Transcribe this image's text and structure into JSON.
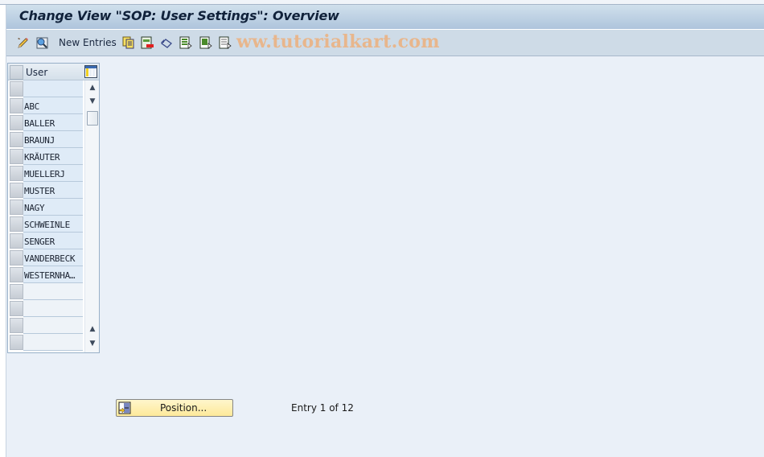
{
  "window": {
    "title": "Change View \"SOP: User Settings\": Overview"
  },
  "toolbar": {
    "items": [
      {
        "icon": "display-change-icon",
        "label": ""
      },
      {
        "icon": "details-icon",
        "label": ""
      },
      {
        "icon": "",
        "label": "New Entries"
      },
      {
        "icon": "copy-as-icon",
        "label": ""
      },
      {
        "icon": "delete-icon",
        "label": ""
      },
      {
        "icon": "undo-change-icon",
        "label": ""
      },
      {
        "icon": "select-all-icon",
        "label": ""
      },
      {
        "icon": "select-block-icon",
        "label": ""
      },
      {
        "icon": "deselect-all-icon",
        "label": ""
      }
    ],
    "new_entries_label": "New Entries",
    "watermark": "ww.tutorialkart.com"
  },
  "table": {
    "column_header": "User",
    "rows": [
      "",
      "ABC",
      "BALLER",
      "BRAUNJ",
      "KRÄUTER",
      "MUELLERJ",
      "MUSTER",
      "NAGY",
      "SCHWEINLE",
      "SENGER",
      "VANDERBECK",
      "WESTERNHA…",
      "",
      "",
      "",
      ""
    ]
  },
  "footer": {
    "position_button_label": "Position...",
    "entry_text": "Entry 1 of 12"
  },
  "colors": {
    "title_bar_top": "#d0e0ec",
    "title_bar_bottom": "#aec4dc",
    "toolbar_bg": "#cedbe7",
    "page_bg": "#eaf0f8",
    "cell_bg": "#dfebf7",
    "button_bg": "#fde99a",
    "watermark": "#f0aa6e"
  }
}
